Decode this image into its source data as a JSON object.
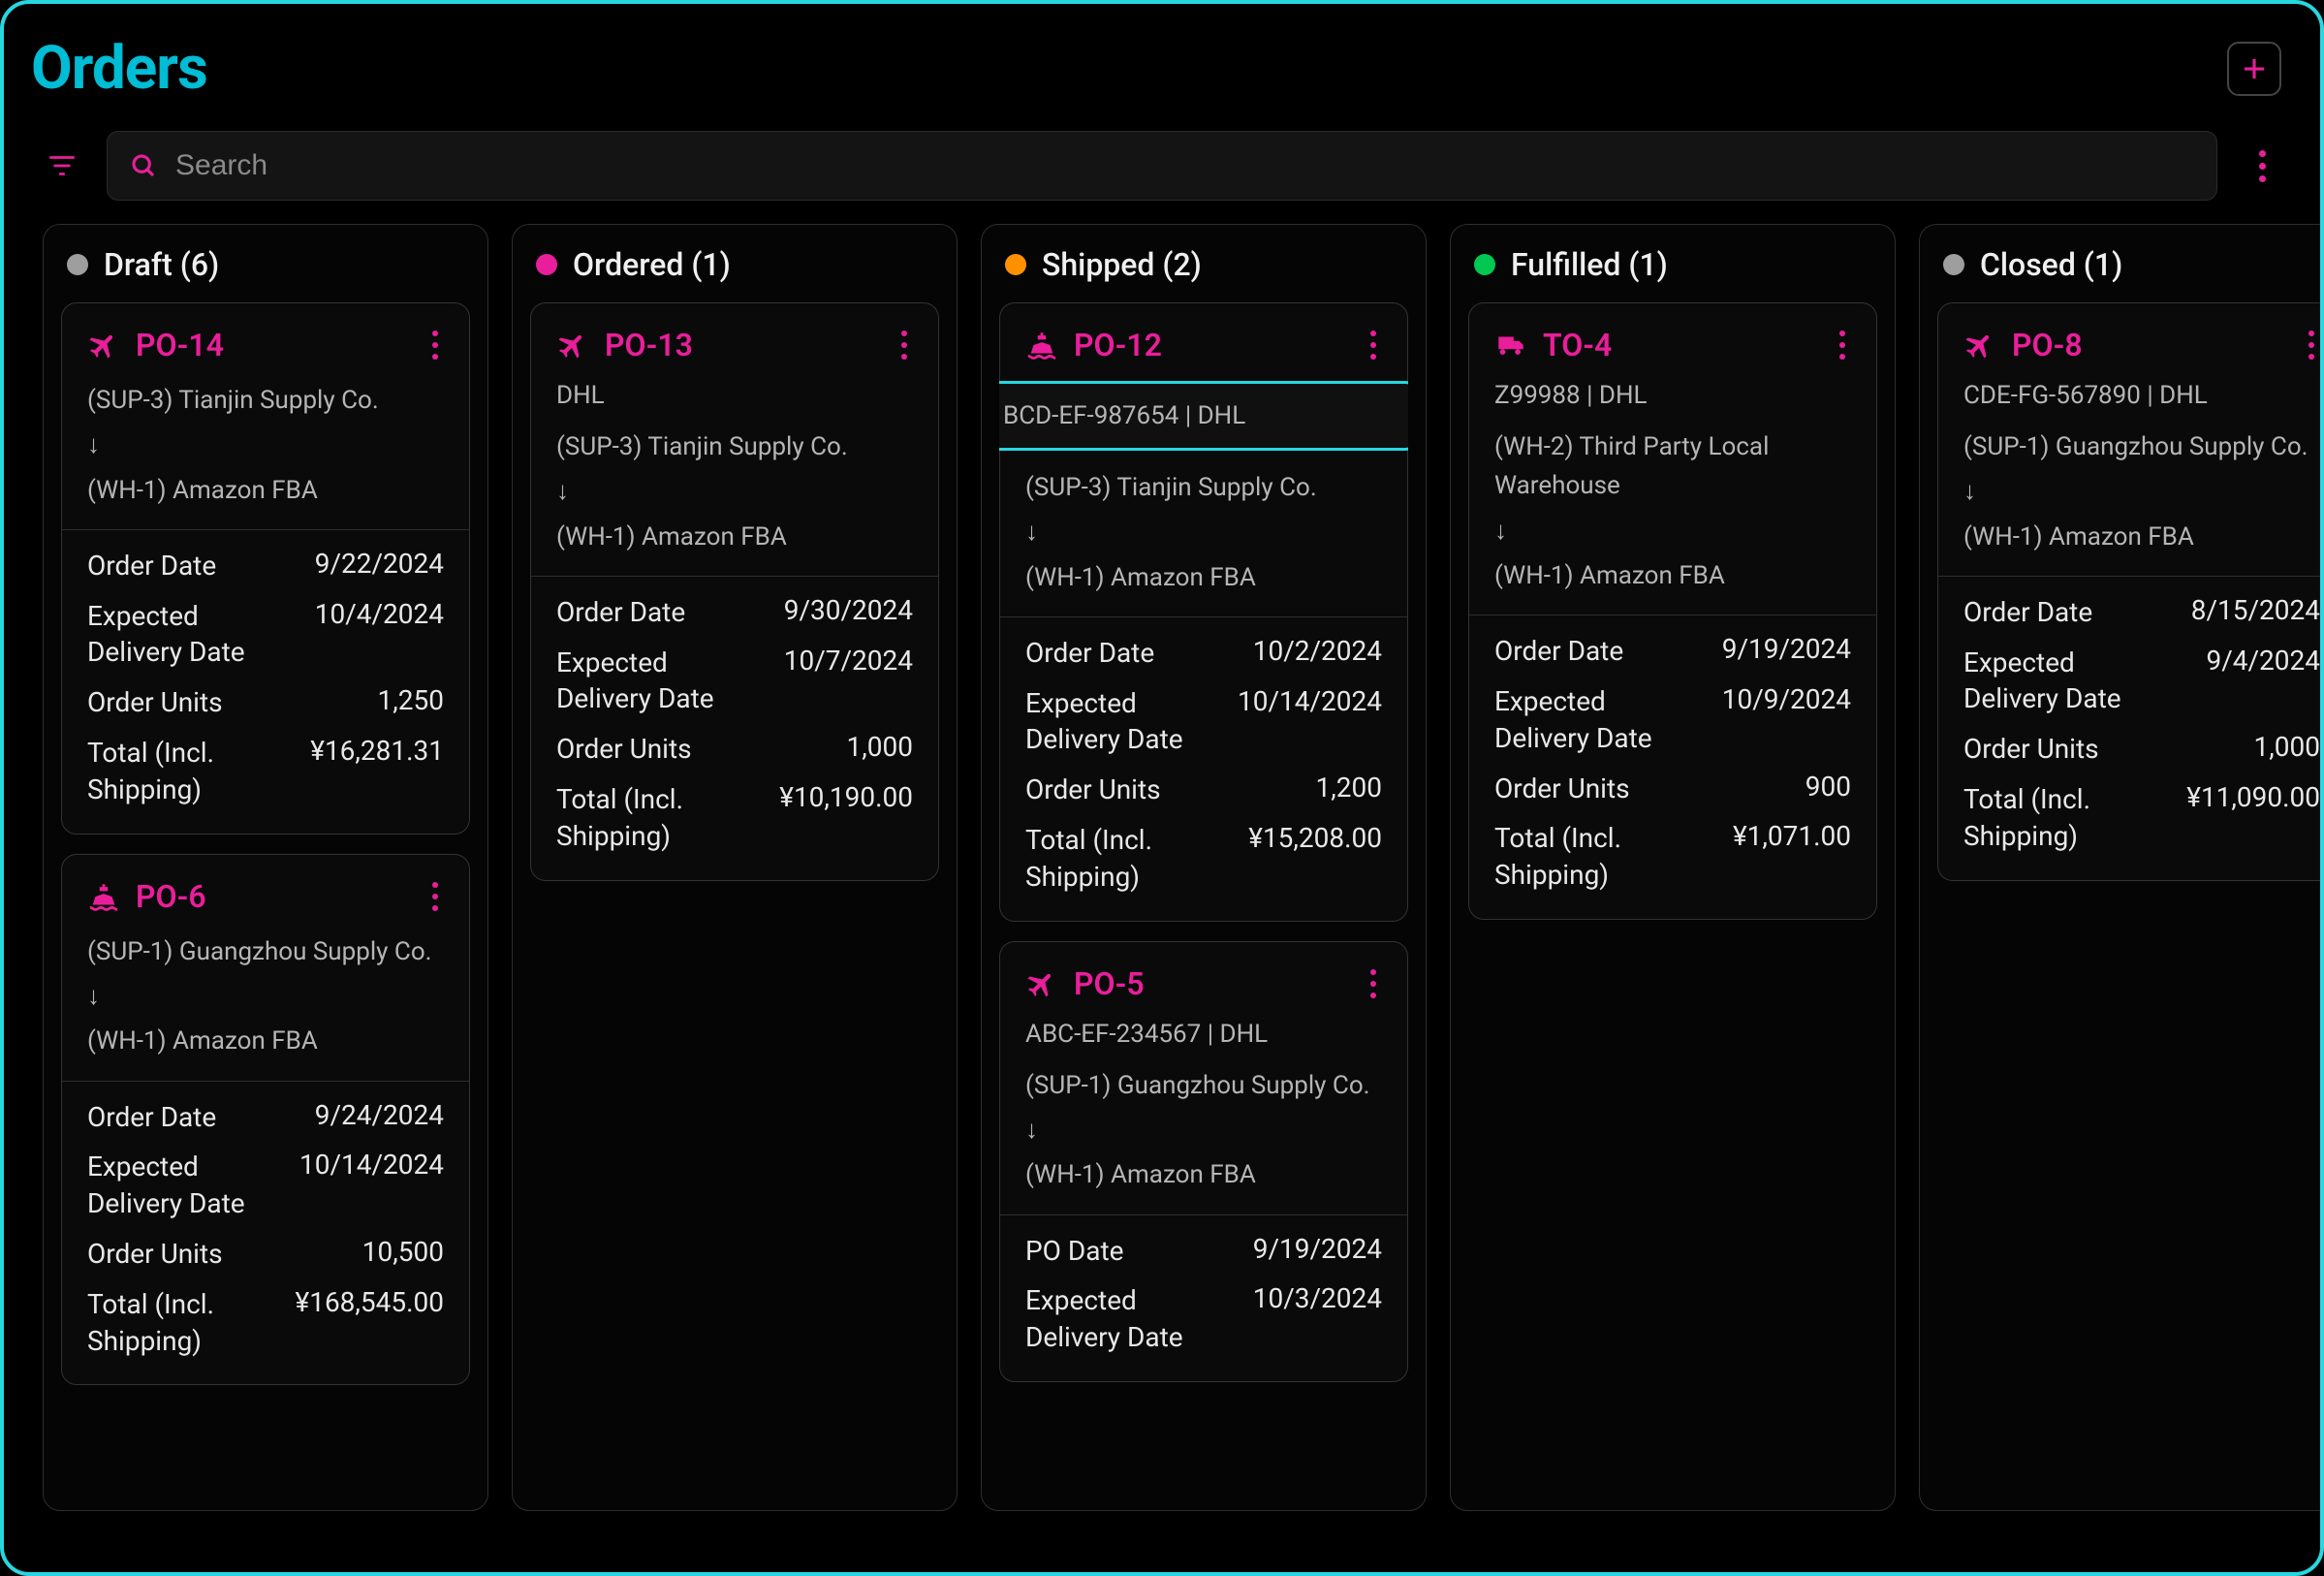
{
  "page": {
    "title": "Orders"
  },
  "search": {
    "placeholder": "Search"
  },
  "labels": {
    "order_date": "Order Date",
    "po_date": "PO Date",
    "expected_delivery": "Expected Delivery Date",
    "order_units": "Order Units",
    "total_incl_shipping": "Total (Incl. Shipping)"
  },
  "columns": [
    {
      "id": "draft",
      "title": "Draft (6)",
      "dot_color": "#9e9e9e",
      "cards": [
        {
          "id": "PO-14",
          "icon": "plane",
          "tracking": null,
          "highlight_tracking": false,
          "from": "(SUP-3) Tianjin Supply Co.",
          "to": "(WH-1) Amazon FBA",
          "rows": [
            {
              "label_key": "order_date",
              "value": "9/22/2024"
            },
            {
              "label_key": "expected_delivery",
              "value": "10/4/2024"
            },
            {
              "label_key": "order_units",
              "value": "1,250"
            },
            {
              "label_key": "total_incl_shipping",
              "value": "¥16,281.31"
            }
          ]
        },
        {
          "id": "PO-6",
          "icon": "ship",
          "tracking": null,
          "highlight_tracking": false,
          "from": "(SUP-1) Guangzhou Supply Co.",
          "to": "(WH-1) Amazon FBA",
          "rows": [
            {
              "label_key": "order_date",
              "value": "9/24/2024"
            },
            {
              "label_key": "expected_delivery",
              "value": "10/14/2024"
            },
            {
              "label_key": "order_units",
              "value": "10,500"
            },
            {
              "label_key": "total_incl_shipping",
              "value": "¥168,545.00"
            }
          ]
        }
      ]
    },
    {
      "id": "ordered",
      "title": "Ordered (1)",
      "dot_color": "#e91e9a",
      "cards": [
        {
          "id": "PO-13",
          "icon": "plane",
          "tracking": "DHL",
          "highlight_tracking": false,
          "from": "(SUP-3) Tianjin Supply Co.",
          "to": "(WH-1) Amazon FBA",
          "rows": [
            {
              "label_key": "order_date",
              "value": "9/30/2024"
            },
            {
              "label_key": "expected_delivery",
              "value": "10/7/2024"
            },
            {
              "label_key": "order_units",
              "value": "1,000"
            },
            {
              "label_key": "total_incl_shipping",
              "value": "¥10,190.00"
            }
          ]
        }
      ]
    },
    {
      "id": "shipped",
      "title": "Shipped (2)",
      "dot_color": "#ff9100",
      "cards": [
        {
          "id": "PO-12",
          "icon": "ship",
          "tracking": "BCD-EF-987654 | DHL",
          "highlight_tracking": true,
          "from": "(SUP-3) Tianjin Supply Co.",
          "to": "(WH-1) Amazon FBA",
          "rows": [
            {
              "label_key": "order_date",
              "value": "10/2/2024"
            },
            {
              "label_key": "expected_delivery",
              "value": "10/14/2024"
            },
            {
              "label_key": "order_units",
              "value": "1,200"
            },
            {
              "label_key": "total_incl_shipping",
              "value": "¥15,208.00"
            }
          ]
        },
        {
          "id": "PO-5",
          "icon": "plane",
          "tracking": "ABC-EF-234567 | DHL",
          "highlight_tracking": false,
          "from": "(SUP-1) Guangzhou Supply Co.",
          "to": "(WH-1) Amazon FBA",
          "rows": [
            {
              "label_key": "po_date",
              "value": "9/19/2024"
            },
            {
              "label_key": "expected_delivery",
              "value": "10/3/2024"
            }
          ]
        }
      ]
    },
    {
      "id": "fulfilled",
      "title": "Fulfilled (1)",
      "dot_color": "#00c853",
      "cards": [
        {
          "id": "TO-4",
          "icon": "truck",
          "tracking": "Z99988 | DHL",
          "highlight_tracking": false,
          "from": "(WH-2) Third Party Local Warehouse",
          "to": "(WH-1) Amazon FBA",
          "rows": [
            {
              "label_key": "order_date",
              "value": "9/19/2024"
            },
            {
              "label_key": "expected_delivery",
              "value": "10/9/2024"
            },
            {
              "label_key": "order_units",
              "value": "900"
            },
            {
              "label_key": "total_incl_shipping",
              "value": "¥1,071.00"
            }
          ]
        }
      ]
    },
    {
      "id": "closed",
      "title": "Closed (1)",
      "dot_color": "#9e9e9e",
      "cards": [
        {
          "id": "PO-8",
          "icon": "plane",
          "tracking": "CDE-FG-567890 | DHL",
          "highlight_tracking": false,
          "from": "(SUP-1) Guangzhou Supply Co.",
          "to": "(WH-1) Amazon FBA",
          "rows": [
            {
              "label_key": "order_date",
              "value": "8/15/2024"
            },
            {
              "label_key": "expected_delivery",
              "value": "9/4/2024"
            },
            {
              "label_key": "order_units",
              "value": "1,000"
            },
            {
              "label_key": "total_incl_shipping",
              "value": "¥11,090.00"
            }
          ]
        }
      ]
    }
  ]
}
